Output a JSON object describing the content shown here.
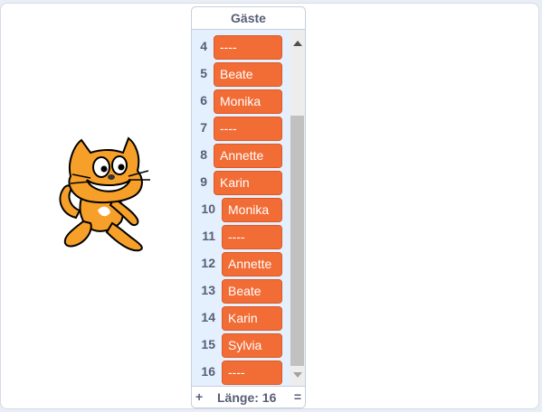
{
  "list_monitor": {
    "title": "Gäste",
    "items": [
      {
        "index": "4",
        "value": "----"
      },
      {
        "index": "5",
        "value": "Beate"
      },
      {
        "index": "6",
        "value": "Monika"
      },
      {
        "index": "7",
        "value": "----"
      },
      {
        "index": "8",
        "value": "Annette"
      },
      {
        "index": "9",
        "value": "Karin"
      },
      {
        "index": "10",
        "value": "Monika"
      },
      {
        "index": "11",
        "value": "----"
      },
      {
        "index": "12",
        "value": "Annette"
      },
      {
        "index": "13",
        "value": "Beate"
      },
      {
        "index": "14",
        "value": "Karin"
      },
      {
        "index": "15",
        "value": "Sylvia"
      },
      {
        "index": "16",
        "value": "----"
      }
    ],
    "add_label": "+",
    "length_text": "Länge: 16",
    "resize_label": "=",
    "scroll_up_icon": "scroll-up-arrow-icon",
    "scroll_down_icon": "scroll-down-arrow-icon"
  },
  "sprite": {
    "icon": "scratch-cat-icon"
  },
  "colors": {
    "item_fill": "#f26c36",
    "monitor_background": "#e5f0ff",
    "label_text": "#575e75",
    "cat_orange": "#f7a029"
  }
}
